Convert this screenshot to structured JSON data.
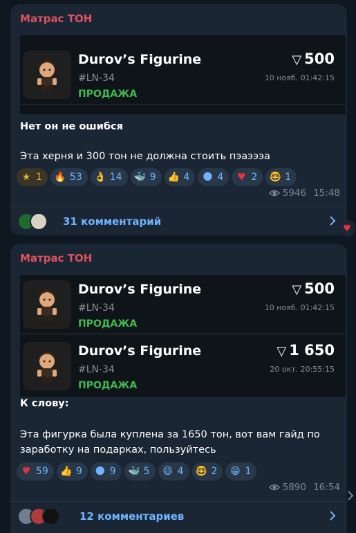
{
  "channel": {
    "name": "Матрас ТОН"
  },
  "posts": [
    {
      "cards": [
        {
          "name": "Durov’s Figurine",
          "code": "#LN-34",
          "status": "ПРОДАЖА",
          "price": "500",
          "datetime": "10 нояб. 01:42:15"
        }
      ],
      "text_line1": "Нет он не ошибся",
      "text_line2": "Эта херня и 300 тон не должна стоить пэаэээа",
      "reactions": [
        {
          "icon": "star-icon",
          "emoji": "★",
          "count": "1",
          "color": "#e2b540"
        },
        {
          "icon": "fire-icon",
          "emoji": "🔥",
          "count": "53"
        },
        {
          "icon": "ok-hand-icon",
          "emoji": "👌",
          "count": "14"
        },
        {
          "icon": "whale-icon",
          "emoji": "🐳",
          "count": "9"
        },
        {
          "icon": "thumbs-up-icon",
          "emoji": "👍",
          "count": "4"
        },
        {
          "icon": "emoji-face-icon",
          "emoji": "🌑",
          "count": "4"
        },
        {
          "icon": "heart-icon",
          "emoji": "♥",
          "count": "2"
        },
        {
          "icon": "nerd-face-icon",
          "emoji": "🤓",
          "count": "1"
        }
      ],
      "views": "5946",
      "time": "15:48",
      "comments": "31 комментарий"
    },
    {
      "cards": [
        {
          "name": "Durov’s Figurine",
          "code": "#LN-34",
          "status": "ПРОДАЖА",
          "price": "500",
          "datetime": "10 нояб. 01:42:15"
        },
        {
          "name": "Durov’s Figurine",
          "code": "#LN-34",
          "status": "ПРОДАЖА",
          "price": "1 650",
          "datetime": "20 окт. 20:55:15"
        }
      ],
      "text_line1": "К слову:",
      "text_line2": "Эта фигурка была куплена за 1650 тон, вот вам гайд по заработку на подарках, пользуйтесь",
      "reactions": [
        {
          "icon": "heart-icon",
          "emoji": "♥",
          "count": "59"
        },
        {
          "icon": "thumbs-up-icon",
          "emoji": "👍",
          "count": "9"
        },
        {
          "icon": "emoji-face-icon",
          "emoji": "🌑",
          "count": "9"
        },
        {
          "icon": "whale-icon",
          "emoji": "🐳",
          "count": "5"
        },
        {
          "icon": "grin-icon",
          "emoji": "😄",
          "count": "4"
        },
        {
          "icon": "nerd-face-icon",
          "emoji": "🤓",
          "count": "2"
        },
        {
          "icon": "sticker-face-icon",
          "emoji": "😁",
          "count": "1"
        }
      ],
      "views": "5890",
      "time": "16:54",
      "comments": "12 комментариев"
    }
  ],
  "colors": {
    "accent": "#6fb5ff",
    "sale_green": "#3fb950",
    "channel_red": "#e0515f",
    "heart": "#e6313e"
  }
}
